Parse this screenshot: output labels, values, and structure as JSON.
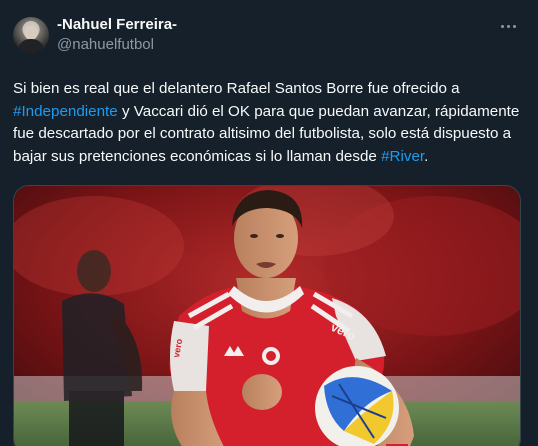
{
  "author": {
    "display_name": "-Nahuel Ferreira-",
    "handle": "@nahuelfutbol"
  },
  "tweet": {
    "text_1": "Si bien es real que el delantero Rafael Santos Borre fue ofrecido a ",
    "hashtag_1": "#Independiente",
    "text_2": " y Vaccari dió el OK para que puedan avanzar, rápidamente fue descartado por el contrato altisimo del futbolista, solo está dispuesto a bajar sus pretenciones económicas si lo llaman desde ",
    "hashtag_2": "#River",
    "text_3": "."
  },
  "media": {
    "jersey_sponsor": "vero",
    "jersey_sleeve_text": "vero"
  },
  "icons": {
    "more": "more-horizontal-icon"
  },
  "colors": {
    "background": "#15202b",
    "link": "#1d9bf0",
    "secondary_text": "#8b98a5",
    "jersey_red": "#d4202c"
  }
}
